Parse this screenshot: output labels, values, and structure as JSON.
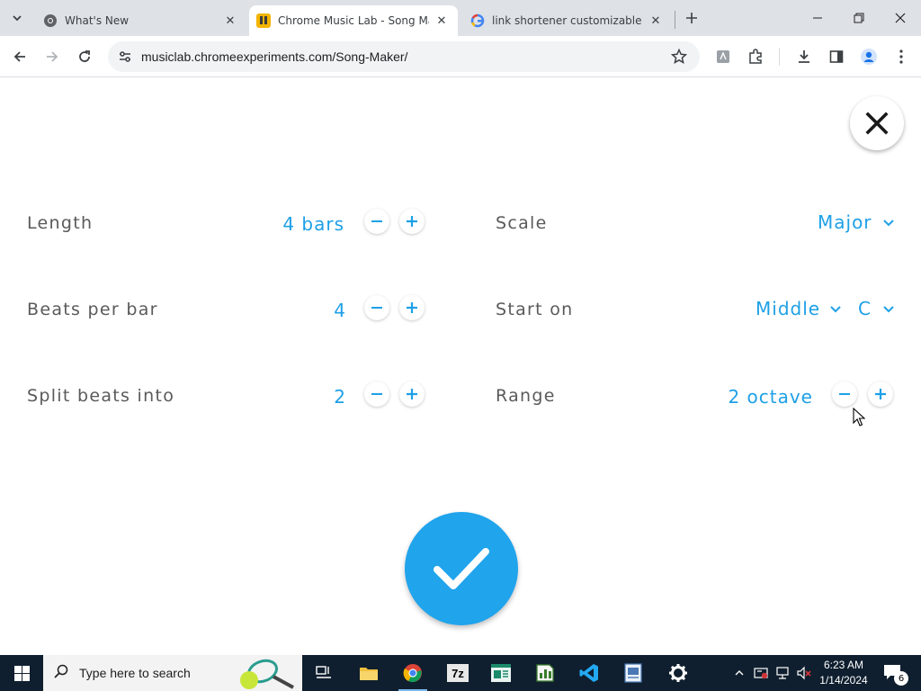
{
  "browser": {
    "tabs": [
      {
        "title": "What's New",
        "icon": "chrome-icon"
      },
      {
        "title": "Chrome Music Lab - Song Maker",
        "icon": "music-lab-icon"
      },
      {
        "title": "link shortener customizable - Google Search",
        "icon": "google-icon"
      }
    ],
    "active_tab": 1,
    "url": "musiclab.chromeexperiments.com/Song-Maker/"
  },
  "settings": {
    "length": {
      "label": "Length",
      "value": "4 bars"
    },
    "beats_per_bar": {
      "label": "Beats per bar",
      "value": "4"
    },
    "split_beats": {
      "label": "Split beats into",
      "value": "2"
    },
    "scale": {
      "label": "Scale",
      "value": "Major"
    },
    "start_on": {
      "label": "Start on",
      "octave": "Middle",
      "note": "C"
    },
    "range": {
      "label": "Range",
      "value": "2 octave"
    }
  },
  "colors": {
    "accent": "#1ea0e6",
    "label": "#5a5a5a"
  },
  "taskbar": {
    "search_placeholder": "Type here to search",
    "time": "6:23 AM",
    "date": "1/14/2024",
    "notification_count": "6"
  }
}
